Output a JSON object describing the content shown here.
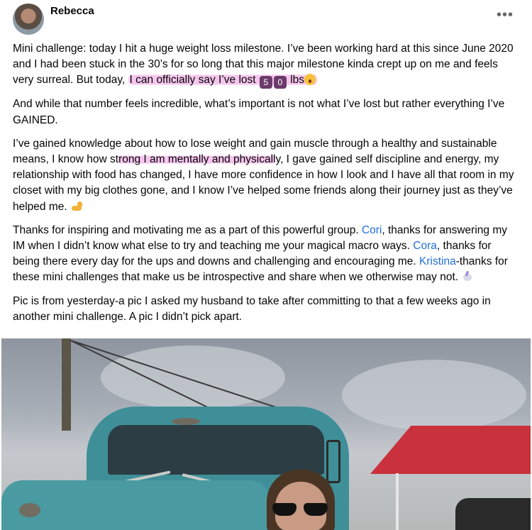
{
  "post": {
    "author": "Rebecca",
    "more_label": "•••",
    "paragraphs": {
      "p1_a": "Mini challenge: today I hit a huge weight loss milestone.  I’ve been working hard at this since June 2020 and I had been stuck in the 30’s for so long that this major milestone kinda crept up on me and feels very surreal. But today, ",
      "p1_highlight": "I can officially say I’ve lost ",
      "p1_key1": "5",
      "p1_key2": "0",
      "p1_lbs": " lbs",
      "p2": "And while that number feels incredible, what’s important is not what I’ve lost but rather everything I’ve GAINED.",
      "p3_a": "I’ve gained knowledge about how to lose weight and gain muscle through a healthy and sustainable means, I know how st",
      "p3_highlight": "rong I am mentally and physicall",
      "p3_b": "y, I gave gained self discipline and energy, my relationship with food has changed, I have more confidence in how I look and I have all that room in my closet with my big clothes gone, and I know I’ve helped some friends along their journey just as they’ve helped me. ",
      "p4_a": "Thanks for inspiring and motivating me as a part of this powerful group. ",
      "p4_link1": "Cori",
      "p4_b": ", thanks for answering my IM when I didn’t know what else to try and teaching me your magical macro ways. ",
      "p4_link2": "Cora",
      "p4_c": ", thanks for being there every day for the ups and downs and challenging and encouraging me. ",
      "p4_link3": "Kristina",
      "p4_d": "-thanks for these mini challenges that make us be introspective and share when we otherwise may not. ",
      "p5": "Pic is from yesterday-a pic I asked my husband to take after committing to that a few weeks ago in another mini challenge. A pic I didn’t pick apart."
    },
    "icons": [
      "surprised-face-emoji",
      "flexed-biceps-emoji",
      "unicorn-emoji",
      "more-options-icon"
    ],
    "colors": {
      "link": "#216fdb",
      "highlight": "#f6c6ee",
      "text": "#050505"
    }
  }
}
